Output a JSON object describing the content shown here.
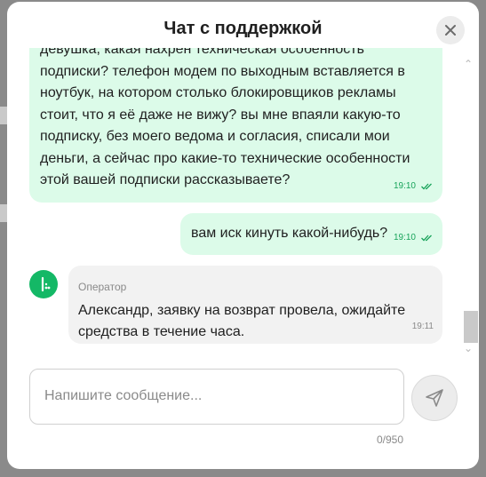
{
  "header": {
    "title": "Чат с поддержкой",
    "close_icon": "close-icon"
  },
  "messages": [
    {
      "side": "out",
      "text": "девушка, какая нахрен техническая особенность подписки? телефон модем по выходным вставляется в ноутбук, на котором столько блокировщиков рекламы стоит, что я её даже не вижу? вы мне впаяли какую-то подписку, без моего ведома и согласия, списали мои деньги, а сейчас про какие-то технические особенности этой вашей подписки рассказываете?",
      "time": "19:10"
    },
    {
      "side": "out",
      "text": "вам иск кинуть какой-нибудь?",
      "time": "19:10"
    },
    {
      "side": "in",
      "sender": "Оператор",
      "text": "Александр, заявку на возврат провела, ожидайте средства в течение часа.",
      "time": "19:11"
    }
  ],
  "composer": {
    "placeholder": "Напишите сообщение...",
    "value": "",
    "counter": "0/950"
  },
  "colors": {
    "accent": "#14b866",
    "outgoing_bubble": "#dcfbe9",
    "incoming_bubble": "#f2f2f2"
  }
}
